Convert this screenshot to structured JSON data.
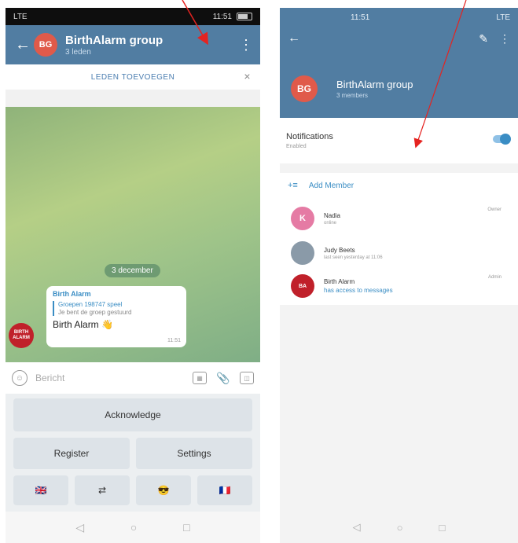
{
  "left": {
    "status": {
      "left": "LTE",
      "right": "11:51"
    },
    "header": {
      "back_icon": "arrow-left-icon",
      "avatar": "BG",
      "title": "BirthAlarm group",
      "subtitle": "3 leden",
      "menu_icon": "kebab-icon"
    },
    "add_members_bar": {
      "label": "LEDEN TOEVOEGEN",
      "close": "×"
    },
    "chat": {
      "date": "3 december",
      "message": {
        "sender": "Birth Alarm",
        "quote_title": "Groepen 198747 speel",
        "quote_text": "Je bent de groep gestuurd",
        "text": "Birth Alarm 👋",
        "time": "11:51"
      },
      "bot_avatar": "BIRTH ALARM"
    },
    "composer": {
      "placeholder": "Bericht"
    },
    "keyboard": {
      "acknowledge": "Acknowledge",
      "register": "Register",
      "settings": "Settings",
      "flags": [
        "🇬🇧",
        "⇄",
        "😎",
        "🇫🇷"
      ]
    },
    "navbar": [
      "◁",
      "○",
      "□"
    ]
  },
  "right": {
    "status": {
      "left": "11:51",
      "right": "LTE"
    },
    "toolbar": {
      "back": "←",
      "edit": "✎",
      "menu": "⋮"
    },
    "profile": {
      "avatar": "BG",
      "title": "BirthAlarm group",
      "subtitle": "3 members"
    },
    "notifications": {
      "label": "Notifications",
      "sub": "Enabled",
      "enabled": true
    },
    "add_member": {
      "icon": "+≡",
      "label": "Add Member"
    },
    "members": [
      {
        "avatar": "K",
        "name": "Nadia",
        "status": "online",
        "role": "Owner",
        "color": "#e57ba4"
      },
      {
        "avatar": "",
        "name": "Judy Beets",
        "status": "last seen yesterday at 11:06",
        "role": "",
        "color": "#8a9aa8"
      },
      {
        "avatar": "BA",
        "name": "Birth Alarm",
        "status": "has access to messages",
        "role": "Admin",
        "color": "#c0202a"
      }
    ],
    "navbar": [
      "◁",
      "○",
      "□"
    ]
  },
  "colors": {
    "header": "#517da2",
    "accent": "#3a8dc4",
    "avatar": "#e05a4a",
    "annotation": "#e52320"
  }
}
